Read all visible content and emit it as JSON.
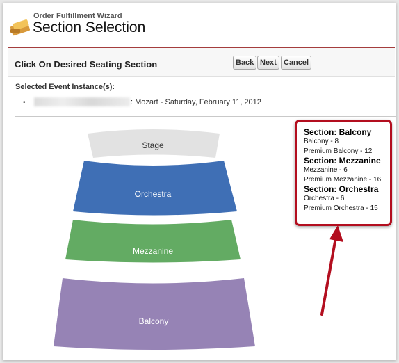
{
  "wizard": {
    "subtitle": "Order Fulfillment Wizard",
    "title": "Section Selection"
  },
  "block": {
    "title": "Click On Desired Seating Section"
  },
  "buttons": {
    "back": "Back",
    "next": "Next",
    "cancel": "Cancel"
  },
  "event": {
    "label": "Selected Event Instance(s):",
    "bullet": "•",
    "text": ": Mozart - Saturday, February 11, 2012"
  },
  "chart": {
    "stage": "Stage",
    "sections": {
      "orchestra": "Orchestra",
      "mezzanine": "Mezzanine",
      "balcony": "Balcony"
    },
    "colors": {
      "stage": "#e2e2e2",
      "orchestra": "#3f6fb5",
      "mezzanine": "#63ab63",
      "balcony": "#9683b5"
    }
  },
  "legend": {
    "groups": [
      {
        "heading": "Section: Balcony",
        "items": [
          "Balcony - 8",
          "Premium Balcony - 12"
        ]
      },
      {
        "heading": "Section: Mezzanine",
        "items": [
          "Mezzanine - 6",
          "Premium Mezzanine - 16"
        ]
      },
      {
        "heading": "Section: Orchestra",
        "items": [
          "Orchestra - 6",
          "Premium Orchestra - 15"
        ]
      }
    ],
    "border_color": "#b30e1f"
  }
}
